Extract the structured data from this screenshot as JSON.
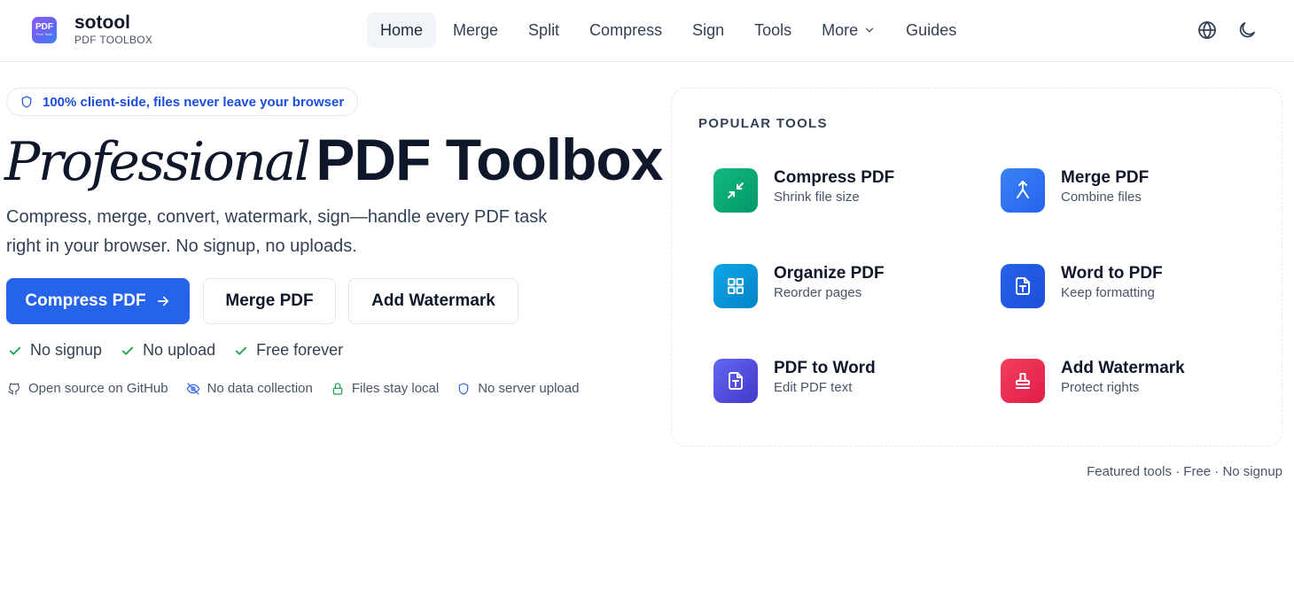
{
  "header": {
    "logo": {
      "line1": "PDF",
      "line2": "Free Tools"
    },
    "brand_name": "sotool",
    "brand_sub": "PDF TOOLBOX",
    "nav": [
      {
        "label": "Home",
        "active": true
      },
      {
        "label": "Merge"
      },
      {
        "label": "Split"
      },
      {
        "label": "Compress"
      },
      {
        "label": "Sign"
      },
      {
        "label": "Tools"
      },
      {
        "label": "More",
        "dropdown": true
      },
      {
        "label": "Guides"
      }
    ],
    "icons": [
      "globe-icon",
      "moon-icon"
    ]
  },
  "hero": {
    "badge": "100% client-side, files never leave your browser",
    "title_italic": "Professional",
    "title_bold": "PDF Toolbox",
    "description": "Compress, merge, convert, watermark, sign—handle every PDF task right in your browser. No signup, no uploads.",
    "buttons": {
      "primary": "Compress PDF",
      "secondary1": "Merge PDF",
      "secondary2": "Add Watermark"
    },
    "checks": [
      "No signup",
      "No upload",
      "Free forever"
    ],
    "trust": [
      "Open source on GitHub",
      "No data collection",
      "Files stay local",
      "No server upload"
    ]
  },
  "popular": {
    "title": "POPULAR TOOLS",
    "tools": [
      {
        "name": "Compress PDF",
        "desc": "Shrink file size",
        "icon": "compress-icon",
        "color": "#10b981"
      },
      {
        "name": "Merge PDF",
        "desc": "Combine files",
        "icon": "merge-icon",
        "color": "#3b82f6"
      },
      {
        "name": "Organize PDF",
        "desc": "Reorder pages",
        "icon": "grid-icon",
        "color": "#0ea5e9"
      },
      {
        "name": "Word to PDF",
        "desc": "Keep formatting",
        "icon": "word-file-icon",
        "color": "#2563eb"
      },
      {
        "name": "PDF to Word",
        "desc": "Edit PDF text",
        "icon": "text-file-icon",
        "color": "#4f46e5"
      },
      {
        "name": "Add Watermark",
        "desc": "Protect rights",
        "icon": "stamp-icon",
        "color": "#ef4444"
      }
    ]
  },
  "footnote": "Featured tools · Free · No signup"
}
